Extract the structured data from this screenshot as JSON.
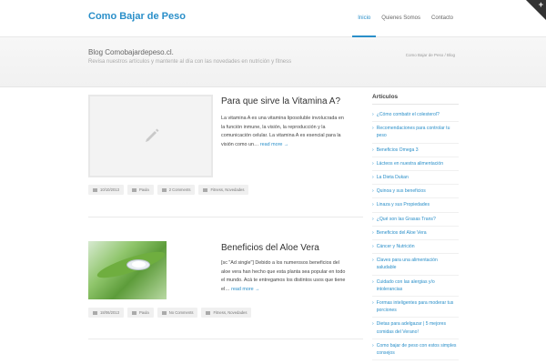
{
  "header": {
    "brand": "Como Bajar de Peso",
    "nav": [
      {
        "label": "Inicio",
        "active": true
      },
      {
        "label": "Quienes Somos",
        "active": false
      },
      {
        "label": "Contacto",
        "active": false
      }
    ],
    "corner_icon": "plus-icon",
    "corner_symbol": "+"
  },
  "banner": {
    "title": "Blog Comobajardepeso.cl.",
    "subtitle": "Revisa nuestros artículos y mantente al día con las novedades en nutrición y fitness",
    "breadcrumb": "Como Bajar de Peso / Blog"
  },
  "posts": [
    {
      "title": "Para que sirve la Vitamina A?",
      "excerpt": "La vitamina A es una vitamina liposoluble involucrada en la función inmune, la visión, la reproducción y la comunicación celular. La vitamina A es esencial para la visión como un… ",
      "read_more": "read more →",
      "image": "pencil-placeholder",
      "meta": {
        "date": "10/10/2013",
        "author": "Paula",
        "comments": "2 Comments",
        "categories": "Fitness, Novedades"
      }
    },
    {
      "title": "Beneficios del Aloe Vera",
      "excerpt": "[sc \"Ad single\"] Debido a los numerosos beneficios del aloe vera han hecho que esta planta sea popular en todo el mundo. Acá te entregamos los distintos usos que tiene el… ",
      "read_more": "read more →",
      "image": "aloe-vera-photo",
      "meta": {
        "date": "18/06/2013",
        "author": "Paula",
        "comments": "No Comments",
        "categories": "Fitness, Novedades"
      }
    }
  ],
  "sidebar": {
    "title": "Artículos",
    "items": [
      "¿Cómo combatir el colesterol?",
      "Recomendaciones para controlar tu peso",
      "Beneficios Omega 3",
      "Lácteos en nuestra alimentación",
      "La Dieta Dukan",
      "Quinoa y sus beneficios",
      "Linaza y sus Propiedades",
      "¿Qué son las Grasas Trans?",
      "Beneficios del Aloe Vera",
      "Cáncer y Nutrición",
      "Claves para una alimentación saludable",
      "Cuidado con las alergias y/o intolerancias",
      "Formas inteligentes para moderar tus porciones",
      "Dietas para adelgazar | 5 mejores comidas del Verano!",
      "Como bajar de peso con estos simples consejos"
    ]
  },
  "colors": {
    "accent": "#2a8fc9",
    "text": "#444444"
  }
}
